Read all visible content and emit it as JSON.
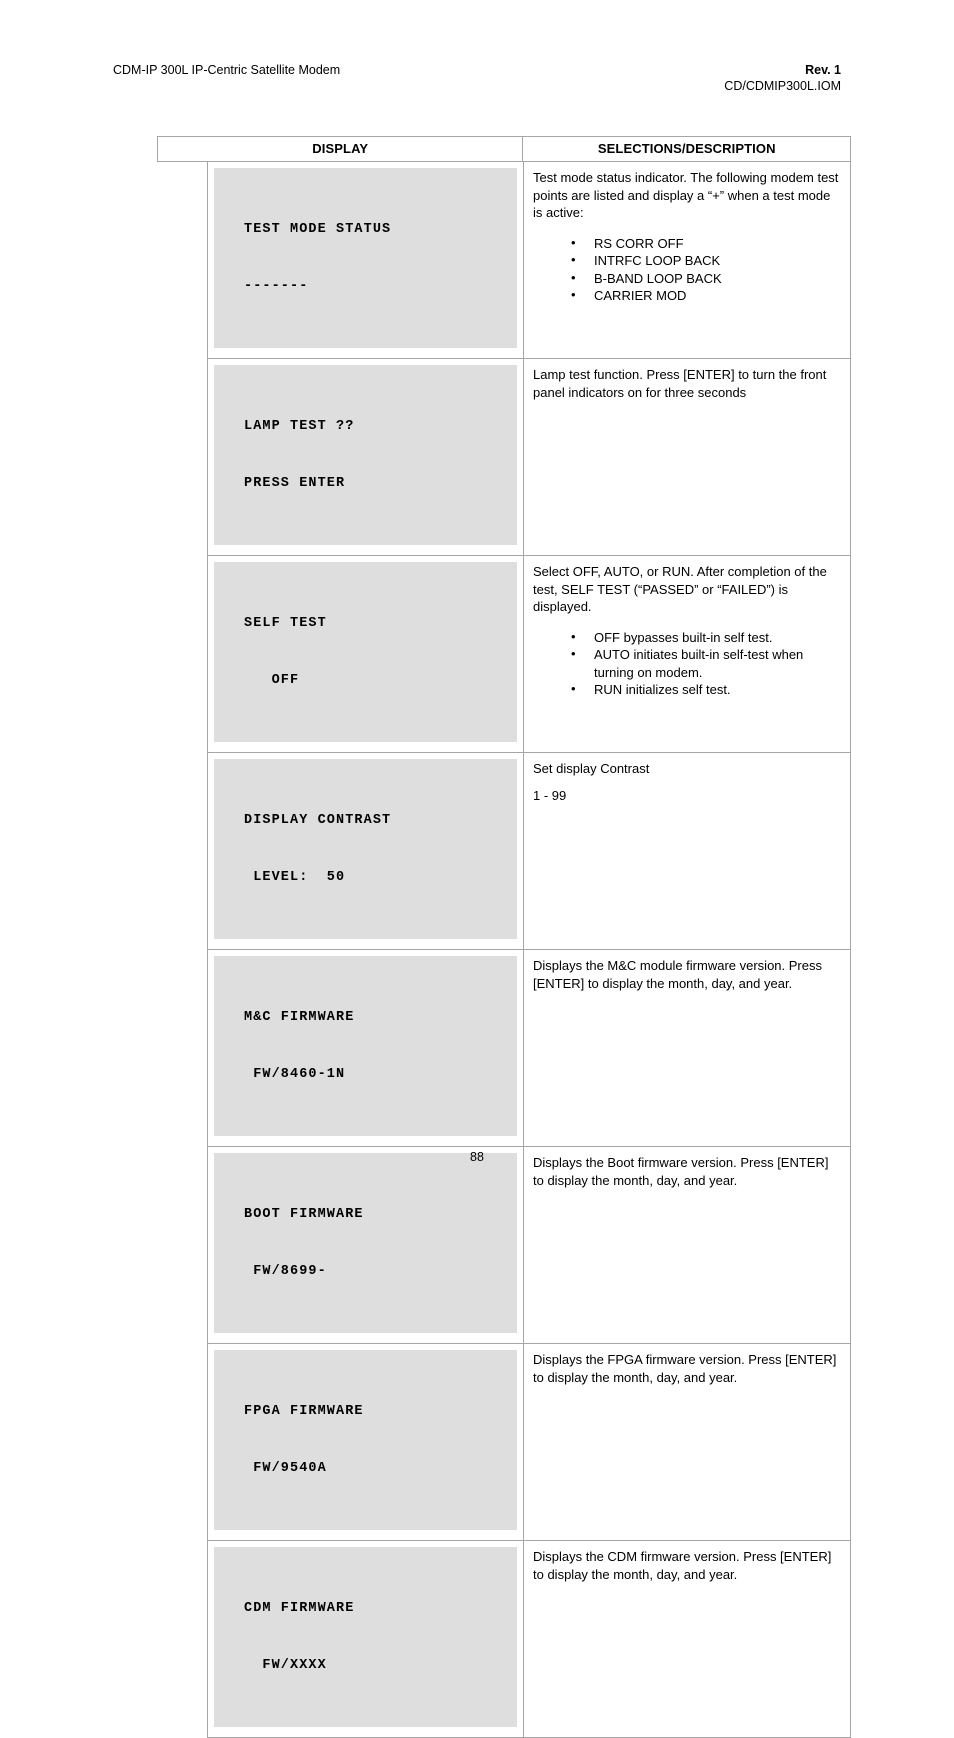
{
  "header": {
    "left": "CDM-IP 300L IP-Centric Satellite Modem",
    "rev": "Rev. 1",
    "doc": "CD/CDMIP300L.IOM"
  },
  "table": {
    "columns": {
      "display": "DISPLAY",
      "selections": "SELECTIONS/DESCRIPTION"
    },
    "rows": [
      {
        "lcd_line1": "TEST MODE STATUS",
        "lcd_line2": "-------",
        "desc_paragraph": "Test mode status indicator. The following modem test points are listed and display a “+” when a test mode is active:",
        "bullets": [
          "RS CORR OFF",
          "INTRFC LOOP BACK",
          "B-BAND LOOP BACK",
          "CARRIER MOD"
        ]
      },
      {
        "lcd_line1": "LAMP TEST ??",
        "lcd_line2": "PRESS ENTER",
        "desc_paragraph": "Lamp test function. Press [ENTER] to turn the front panel indicators on for three seconds",
        "bullets": []
      },
      {
        "lcd_line1": "SELF TEST",
        "lcd_line2": "   OFF",
        "desc_paragraph": "Select OFF, AUTO, or RUN. After completion of the test, SELF TEST (“PASSED” or “FAILED”) is displayed.",
        "bullets": [
          "OFF bypasses built-in self test.",
          "AUTO initiates built-in self-test when turning on modem.",
          "RUN initializes self test."
        ]
      },
      {
        "lcd_line1": "DISPLAY CONTRAST",
        "lcd_line2": " LEVEL:  50",
        "desc_paragraph": "Set display Contrast",
        "desc_paragraph2": "1 - 99",
        "bullets": []
      },
      {
        "lcd_line1": "M&C FIRMWARE",
        "lcd_line2": " FW/8460-1N",
        "desc_paragraph": "Displays the M&C module firmware version. Press [ENTER] to display  the month, day, and year.",
        "bullets": []
      },
      {
        "lcd_line1": "BOOT FIRMWARE",
        "lcd_line2": " FW/8699-",
        "desc_paragraph": "Displays the Boot firmware version. Press [ENTER] to display  the month, day, and year.",
        "bullets": []
      },
      {
        "lcd_line1": "FPGA FIRMWARE",
        "lcd_line2": " FW/9540A",
        "desc_paragraph": "Displays the FPGA firmware version. Press [ENTER] to display  the month, day, and year.",
        "bullets": []
      },
      {
        "lcd_line1": "CDM FIRMWARE",
        "lcd_line2": "  FW/XXXX",
        "desc_paragraph": "Displays the CDM firmware version. Press [ENTER] to display  the month, day, and year.",
        "bullets": []
      }
    ]
  },
  "footer": {
    "page_number": "88"
  },
  "colors": {
    "lcd_background": "#dedede",
    "border": "#a6a6a6",
    "text": "#000000"
  }
}
